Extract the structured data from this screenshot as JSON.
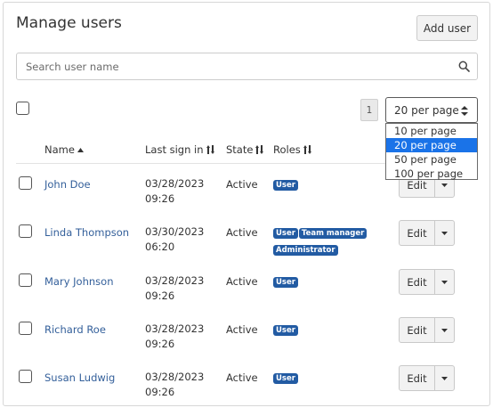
{
  "page": {
    "title": "Manage users",
    "add_user_label": "Add user"
  },
  "search": {
    "placeholder": "Search user name",
    "value": ""
  },
  "pagination": {
    "current_page": "1",
    "per_page_selected": "20 per page",
    "per_page_options": [
      "10 per page",
      "20 per page",
      "50 per page",
      "100 per page"
    ],
    "dropdown_open": true
  },
  "table": {
    "columns": {
      "name": "Name",
      "last_sign_in": "Last sign in",
      "state": "State",
      "roles": "Roles"
    },
    "sort": {
      "column": "Name",
      "direction": "ascending"
    },
    "edit_label": "Edit",
    "rows": [
      {
        "name": "John Doe",
        "date": "03/28/2023",
        "time": "09:26",
        "state": "Active",
        "roles": [
          "User"
        ],
        "checked": false
      },
      {
        "name": "Linda Thompson",
        "date": "03/30/2023",
        "time": "06:20",
        "state": "Active",
        "roles": [
          "User",
          "Team manager",
          "Administrator"
        ],
        "checked": false
      },
      {
        "name": "Mary Johnson",
        "date": "03/28/2023",
        "time": "09:26",
        "state": "Active",
        "roles": [
          "User"
        ],
        "checked": false
      },
      {
        "name": "Richard Roe",
        "date": "03/28/2023",
        "time": "09:26",
        "state": "Active",
        "roles": [
          "User"
        ],
        "checked": false
      },
      {
        "name": "Susan Ludwig",
        "date": "03/28/2023",
        "time": "09:26",
        "state": "Active",
        "roles": [
          "User"
        ],
        "checked": false
      }
    ]
  },
  "colors": {
    "link": "#335f9a",
    "badge": "#225ba3",
    "option_highlight": "#1a73e8"
  },
  "icons": {
    "search": "search-icon",
    "sort_ascending": "sort-ascending-icon",
    "sortable": "sort-icon",
    "select_arrows": "select-arrows-icon",
    "dropdown_caret": "caret-down-icon"
  }
}
